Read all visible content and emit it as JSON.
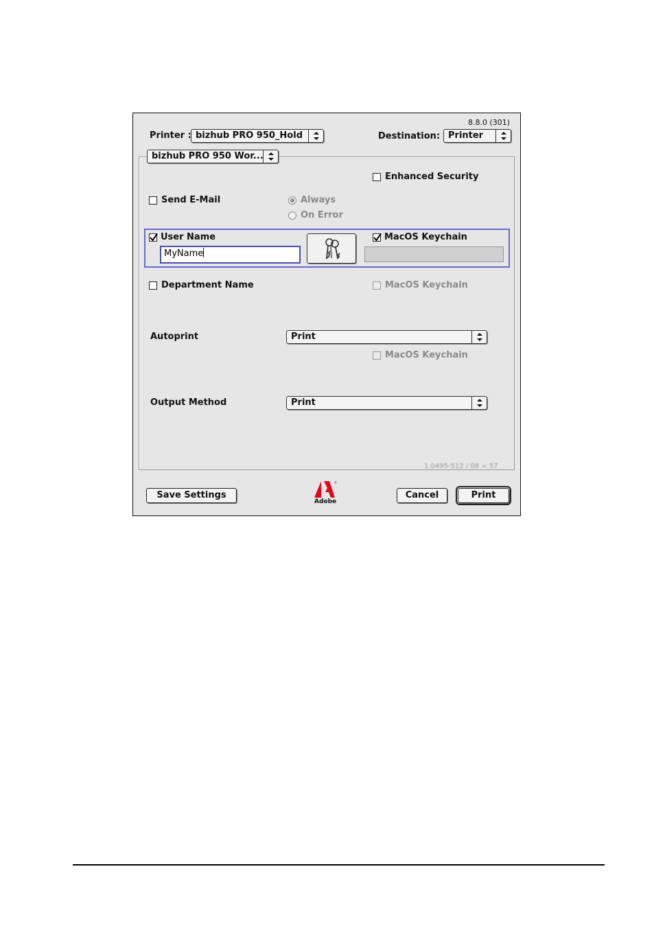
{
  "dialog": {
    "version": "8.8.0 (301)",
    "printer_label": "Printer :",
    "printer_value": "bizhub PRO 950_Hold",
    "destination_label": "Destination:",
    "destination_value": "Printer",
    "panel_menu_value": "bizhub PRO 950 Wor...",
    "enhanced_security": "Enhanced Security",
    "send_email": "Send E-Mail",
    "always": "Always",
    "on_error": "On Error",
    "user_name": "User Name",
    "user_name_value": "MyName",
    "macos_keychain": "MacOS Keychain",
    "department_name": "Department Name",
    "department_keychain": "MacOS Keychain",
    "autoprint_label": "Autoprint",
    "autoprint_value": "Print",
    "autoprint_keychain": "MacOS Keychain",
    "output_method_label": "Output Method",
    "output_method_value": "Print",
    "status_text": "1.0495-512 / 08 = 57",
    "save_settings": "Save Settings",
    "adobe_label": "Adobe",
    "cancel": "Cancel",
    "print": "Print"
  },
  "colors": {
    "dialog_bg": "#e6e6e6",
    "focus_blue": "#4a4ab8",
    "adobe_red": "#e30613"
  },
  "icons": [
    "keys-icon",
    "adobe-logo-icon",
    "popup-arrows-icon",
    "checkmark-icon"
  ]
}
